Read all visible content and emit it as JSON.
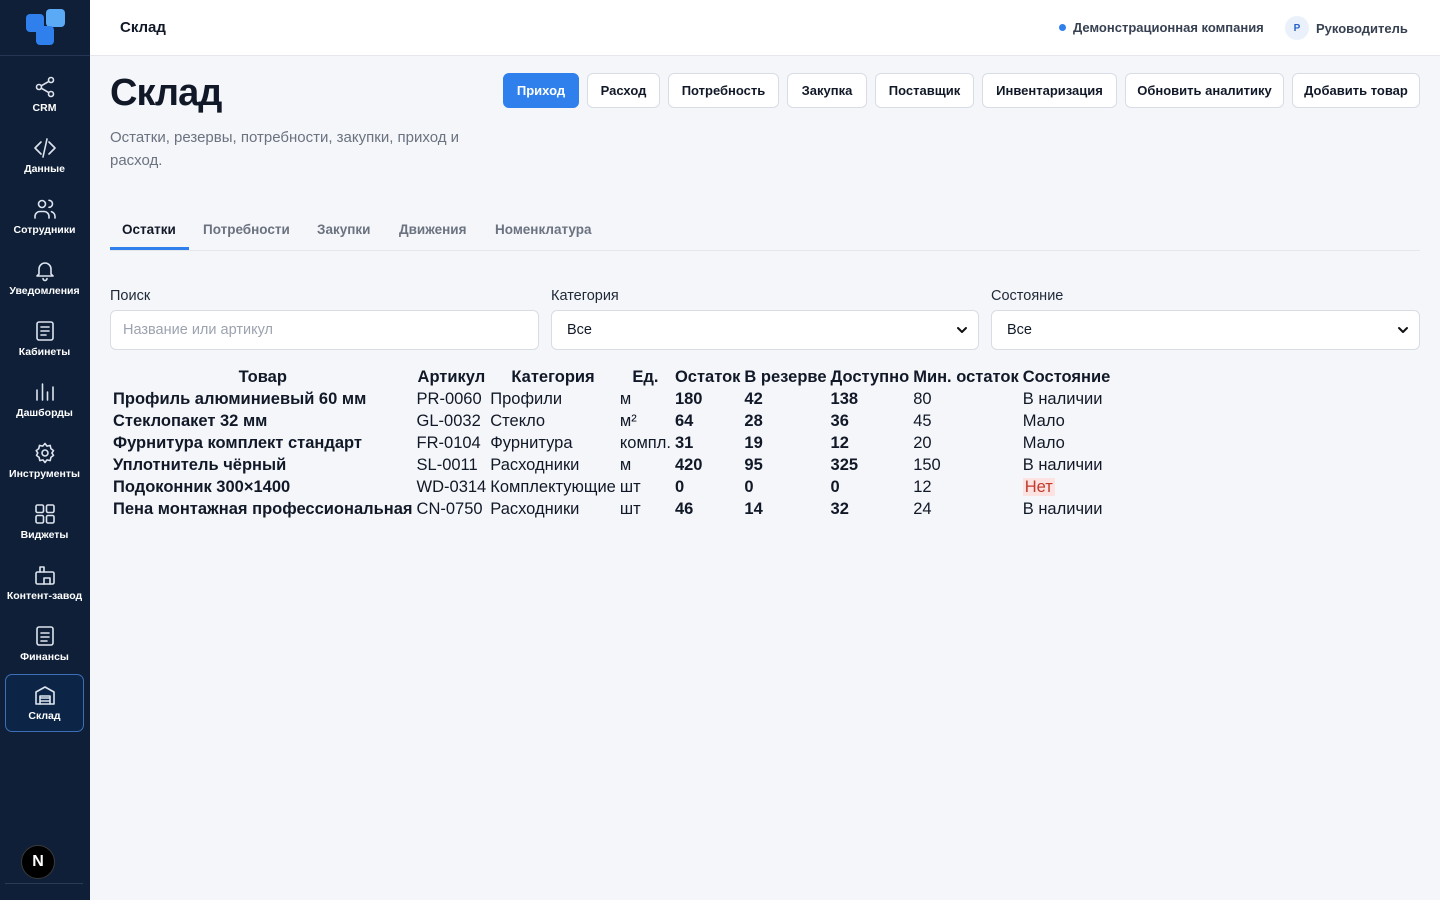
{
  "sidebar": {
    "items": [
      {
        "label": "CRM",
        "icon": "share-icon",
        "active": false
      },
      {
        "label": "Данные",
        "icon": "code-icon",
        "active": false
      },
      {
        "label": "Сотрудники",
        "icon": "users-icon",
        "active": false
      },
      {
        "label": "Уведомления",
        "icon": "bell-icon",
        "active": false
      },
      {
        "label": "Кабинеты",
        "icon": "document-icon",
        "active": false
      },
      {
        "label": "Дашборды",
        "icon": "bar-chart-icon",
        "active": false
      },
      {
        "label": "Инструменты",
        "icon": "gear-icon",
        "active": false
      },
      {
        "label": "Виджеты",
        "icon": "grid-icon",
        "active": false
      },
      {
        "label": "Контент-завод",
        "icon": "factory-icon",
        "active": false
      },
      {
        "label": "Финансы",
        "icon": "receipt-icon",
        "active": false
      },
      {
        "label": "Склад",
        "icon": "warehouse-icon",
        "active": true
      }
    ],
    "bottom_badge": "N"
  },
  "topbar": {
    "title": "Склад",
    "company": "Демонстрационная компания",
    "user_initial": "Р",
    "user_role": "Руководитель"
  },
  "page": {
    "title": "Склад",
    "subtitle": "Остатки, резервы, потребности, закупки, приход и расход."
  },
  "actions": [
    "Приход",
    "Расход",
    "Потребность",
    "Закупка",
    "Поставщик",
    "Инвентаризация",
    "Обновить аналитику",
    "Добавить товар"
  ],
  "tabs": [
    "Остатки",
    "Потребности",
    "Закупки",
    "Движения",
    "Номенклатура"
  ],
  "active_tab": "Остатки",
  "filters": {
    "search_label": "Поиск",
    "search_placeholder": "Название или артикул",
    "category_label": "Категория",
    "category_value": "Все",
    "state_label": "Состояние",
    "state_value": "Все"
  },
  "table": {
    "headers": [
      "Товар",
      "Артикул",
      "Категория",
      "Ед.",
      "Остаток",
      "В резерве",
      "Доступно",
      "Мин. остаток",
      "Состояние"
    ],
    "rows": [
      [
        "Профиль алюминиевый 60 мм",
        "PR-0060",
        "Профили",
        "м",
        "180",
        "42",
        "138",
        "80",
        "В наличии"
      ],
      [
        "Стеклопакет 32 мм",
        "GL-0032",
        "Стекло",
        "м²",
        "64",
        "28",
        "36",
        "45",
        "Мало"
      ],
      [
        "Фурнитура комплект стандарт",
        "FR-0104",
        "Фурнитура",
        "компл.",
        "31",
        "19",
        "12",
        "20",
        "Мало"
      ],
      [
        "Уплотнитель чёрный",
        "SL-0011",
        "Расходники",
        "м",
        "420",
        "95",
        "325",
        "150",
        "В наличии"
      ],
      [
        "Подоконник 300×1400",
        "WD-0314",
        "Комплектующие",
        "шт",
        "0",
        "0",
        "0",
        "12",
        "Нет"
      ],
      [
        "Пена монтажная профессиональная",
        "CN-0750",
        "Расходники",
        "шт",
        "46",
        "14",
        "32",
        "24",
        "В наличии"
      ]
    ]
  },
  "colors": {
    "sidebar_bg": "#0f1f38",
    "accent": "#2f80ed",
    "status_none_bg": "#fde2e2",
    "status_none_fg": "#c0392b"
  }
}
